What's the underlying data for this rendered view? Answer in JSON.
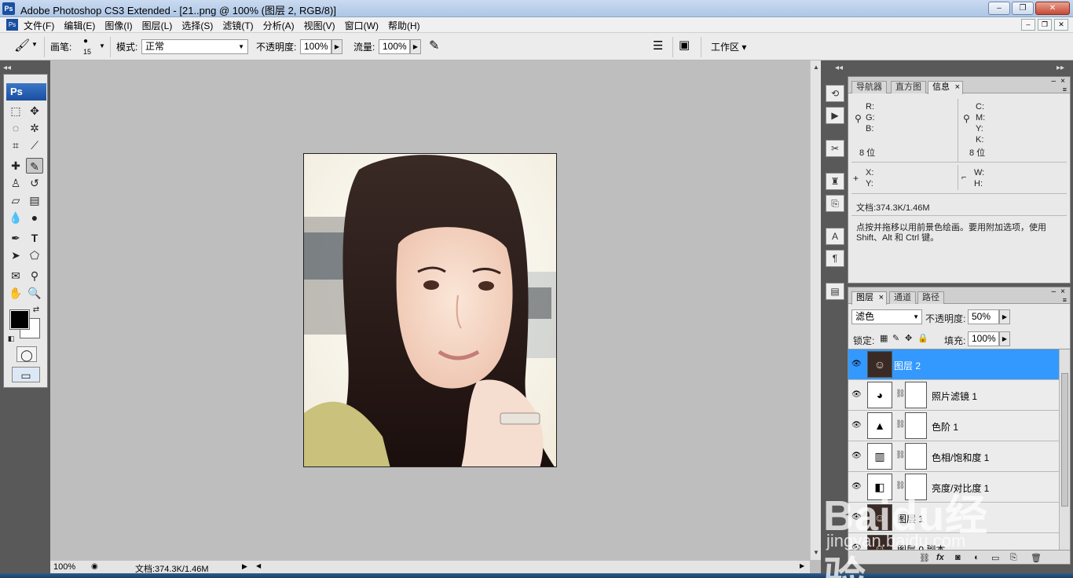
{
  "window": {
    "title": "Adobe Photoshop CS3 Extended - [21..png @ 100% (图层 2, RGB/8)]",
    "logo": "Ps",
    "controls": [
      "–",
      "❐",
      "✕"
    ]
  },
  "menubar": {
    "items": [
      "文件(F)",
      "编辑(E)",
      "图像(I)",
      "图层(L)",
      "选择(S)",
      "滤镜(T)",
      "分析(A)",
      "视图(V)",
      "窗口(W)",
      "帮助(H)"
    ],
    "mdi_controls": [
      "–",
      "❐",
      "✕"
    ]
  },
  "options": {
    "brush_label": "画笔:",
    "brush_size": "15",
    "mode_label": "模式:",
    "mode_value": "正常",
    "opacity_label": "不透明度:",
    "opacity_value": "100%",
    "flow_label": "流量:",
    "flow_value": "100%",
    "workspace_label": "工作区 ▾"
  },
  "toolbox": {
    "logo": "Ps"
  },
  "canvas": {
    "zoom": "100%",
    "doc_info": "文档:374.3K/1.46M"
  },
  "info_panel": {
    "tabs": [
      "导航器",
      "直方图",
      "信息"
    ],
    "active_tab": "信息",
    "rgb_labels": [
      "R:",
      "G:",
      "B:"
    ],
    "cmyk_labels": [
      "C:",
      "M:",
      "Y:",
      "K:"
    ],
    "bit_left": "8 位",
    "bit_right": "8 位",
    "xy_labels": [
      "X:",
      "Y:"
    ],
    "wh_labels": [
      "W:",
      "H:"
    ],
    "doc": "文档:374.3K/1.46M",
    "hint": "点按并拖移以用前景色绘画。要用附加选项，使用 Shift、Alt 和 Ctrl 键。"
  },
  "layers_panel": {
    "tabs": [
      "图层",
      "通道",
      "路径"
    ],
    "active_tab": "图层",
    "blend_mode": "滤色",
    "opacity_label": "不透明度:",
    "opacity_value": "50%",
    "lock_label": "锁定:",
    "fill_label": "填充:",
    "fill_value": "100%",
    "layers": [
      {
        "name": "图层 2",
        "active": true,
        "has_mask": false
      },
      {
        "name": "照片滤镜 1",
        "active": false,
        "has_mask": true
      },
      {
        "name": "色阶 1",
        "active": false,
        "has_mask": true
      },
      {
        "name": "色相/饱和度 1",
        "active": false,
        "has_mask": true
      },
      {
        "name": "亮度/对比度 1",
        "active": false,
        "has_mask": true
      },
      {
        "name": "图层 1",
        "active": false,
        "has_mask": false
      },
      {
        "name": "图层 0 副本",
        "active": false,
        "has_mask": false
      }
    ]
  },
  "watermark": {
    "text": "Baidu经验",
    "subtext": "jingyan.baidu.com"
  }
}
